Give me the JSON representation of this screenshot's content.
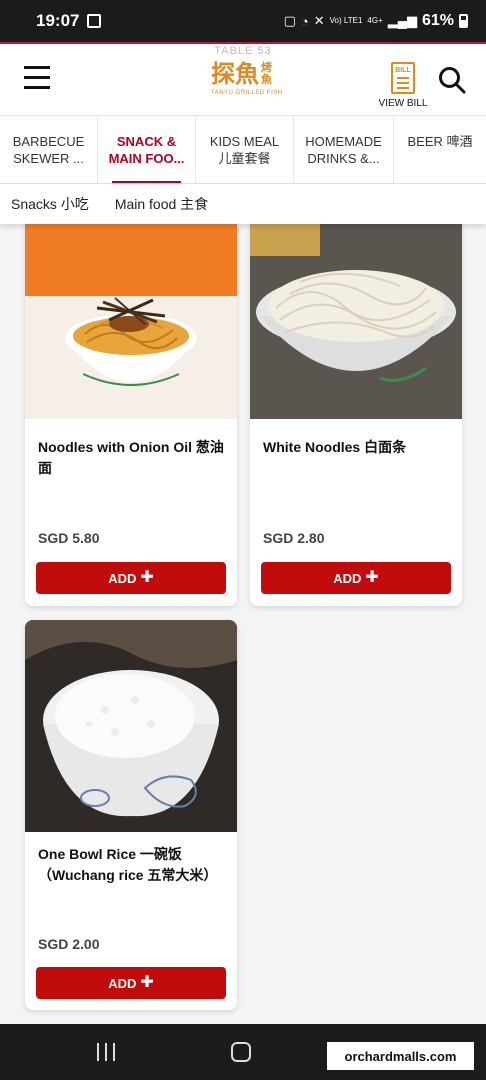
{
  "status_bar": {
    "time": "19:07",
    "network_label": "Vo) LTE1",
    "signal_label": "4G+",
    "battery": "61%"
  },
  "header": {
    "table_label": "TABLE 53",
    "logo_text": "探魚",
    "logo_side": "烤魚",
    "logo_sub": "TANYU GRILLED FISH",
    "bill_icon_text": "BILL",
    "bill_label": "VIEW BILL"
  },
  "categories": [
    {
      "line1": "BARBECUE",
      "line2": "SKEWER ..."
    },
    {
      "line1": "SNACK &",
      "line2": "MAIN FOO..."
    },
    {
      "line1": "KIDS MEAL",
      "line2": "儿童套餐"
    },
    {
      "line1": "HOMEMADE",
      "line2": "DRINKS &..."
    },
    {
      "line1": "BEER 啤酒",
      "line2": ""
    }
  ],
  "sub_categories": [
    "Snacks 小吃",
    "Main food 主食"
  ],
  "items": [
    {
      "name": "Noodles with Onion Oil 葱油面",
      "price": "SGD 5.80",
      "add_label": "ADD"
    },
    {
      "name": "White Noodles 白面条",
      "price": "SGD 2.80",
      "add_label": "ADD"
    },
    {
      "name": "One Bowl Rice 一碗饭（Wuchang rice 五常大米）",
      "price": "SGD 2.00",
      "add_label": "ADD"
    }
  ],
  "watermark": "orchardmalls.com",
  "colors": {
    "accent": "#c20b0b",
    "brand": "#e08a1e"
  }
}
